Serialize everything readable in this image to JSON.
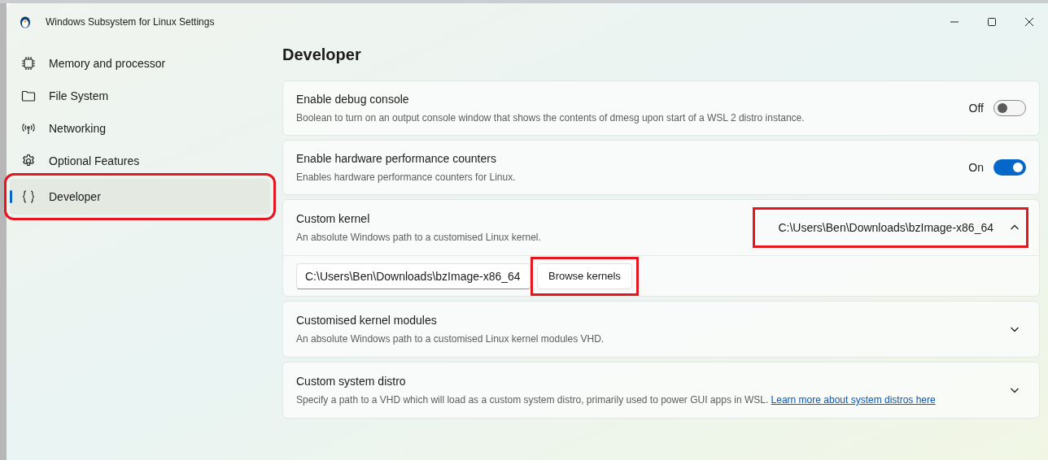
{
  "window": {
    "title": "Windows Subsystem for Linux Settings"
  },
  "sidebar": {
    "items": [
      {
        "label": "Memory and processor",
        "kind": "chip",
        "selected": false,
        "highlighted": false
      },
      {
        "label": "File System",
        "kind": "folder",
        "selected": false,
        "highlighted": false
      },
      {
        "label": "Networking",
        "kind": "antenna",
        "selected": false,
        "highlighted": false
      },
      {
        "label": "Optional Features",
        "kind": "gear",
        "selected": false,
        "highlighted": false
      },
      {
        "label": "Developer",
        "kind": "braces",
        "selected": true,
        "highlighted": true
      }
    ]
  },
  "page": {
    "title": "Developer"
  },
  "settings": [
    {
      "kind": "toggle",
      "title": "Enable debug console",
      "description": "Boolean to turn on an output console window that shows the contents of dmesg upon start of a WSL 2 distro instance.",
      "state_label": "Off",
      "on": false
    },
    {
      "kind": "toggle",
      "title": "Enable hardware performance counters",
      "description": "Enables hardware performance counters for Linux.",
      "state_label": "On",
      "on": true
    },
    {
      "kind": "expander",
      "title": "Custom kernel",
      "description": "An absolute Windows path to a customised Linux kernel.",
      "value": "C:\\Users\\Ben\\Downloads\\bzImage-x86_64",
      "value_highlighted": true,
      "expanded": true,
      "field_value": "C:\\Users\\Ben\\Downloads\\bzImage-x86_64",
      "button": "Browse kernels",
      "button_highlighted": true
    },
    {
      "kind": "expander",
      "title": "Customised kernel modules",
      "description": "An absolute Windows path to a customised Linux kernel modules VHD.",
      "expanded": false
    },
    {
      "kind": "expander",
      "title": "Custom system distro",
      "description": "Specify a path to a VHD which will load as a custom system distro, primarily used to power GUI apps in WSL.",
      "link": "Learn more about system distros here",
      "expanded": false
    }
  ]
}
